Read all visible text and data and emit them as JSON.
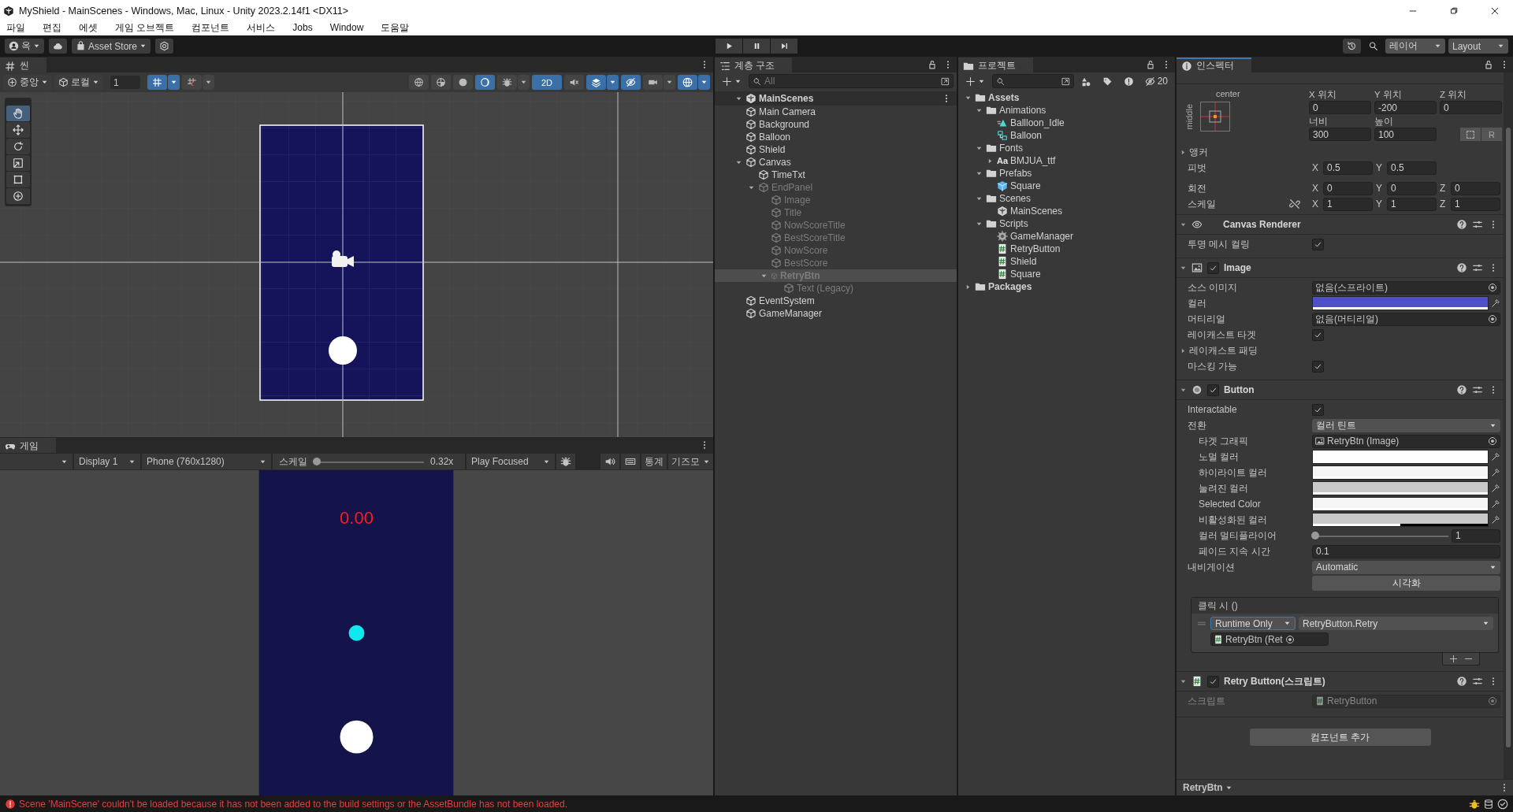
{
  "window": {
    "title": "MyShield - MainScenes - Windows, Mac, Linux - Unity 2023.2.14f1 <DX11>"
  },
  "menu": [
    "파일",
    "편집",
    "에셋",
    "게임 오브젝트",
    "컴포넌트",
    "서비스",
    "Jobs",
    "Window",
    "도움말"
  ],
  "toolbar": {
    "account": "옥",
    "asset_store": "Asset Store",
    "layers": "레이어",
    "layout": "Layout"
  },
  "scene": {
    "tab": "씬",
    "pivot": "중앙",
    "space": "로컬",
    "increment": "1",
    "snap_toggles": [
      {
        "kind": "grid",
        "on": true
      },
      {
        "kind": "snap",
        "on": false
      }
    ],
    "view_toggles": [
      {
        "kind": "wireframe",
        "on": false
      },
      {
        "kind": "shaded_wireframe",
        "on": false
      },
      {
        "kind": "shaded",
        "on": false
      },
      {
        "kind": "unlit",
        "on": true
      },
      {
        "kind": "debug",
        "on": false
      },
      {
        "kind": "mode_2d",
        "label": "2D",
        "on": true
      },
      {
        "kind": "audio",
        "on": false
      },
      {
        "kind": "effects",
        "on": true
      },
      {
        "kind": "visibility",
        "on": true
      },
      {
        "kind": "camera",
        "on": false
      },
      {
        "kind": "gizmos",
        "on": true
      }
    ],
    "tools": [
      {
        "kind": "hand",
        "selected": true
      },
      {
        "kind": "move",
        "selected": false
      },
      {
        "kind": "rotate",
        "selected": false
      },
      {
        "kind": "scale",
        "selected": false
      },
      {
        "kind": "rect",
        "selected": false
      },
      {
        "kind": "transform",
        "selected": false
      }
    ]
  },
  "game": {
    "tab": "게임",
    "display": "Display 1",
    "resolution": "Phone (760x1280)",
    "scale_label": "스케일",
    "scale": {
      "level": 0
    },
    "scale_value": "0.32x",
    "play_mode": "Play Focused",
    "stats": "통계",
    "gizmos": "기즈모",
    "timer": "0.00"
  },
  "hierarchy": {
    "tab": "계층 구조",
    "search": {
      "placeholder": "All"
    },
    "scene": {
      "name": "MainScenes",
      "expanded": true
    },
    "items": [
      {
        "name": "Main Camera",
        "active": true,
        "selected": false
      },
      {
        "name": "Background",
        "active": true,
        "selected": false
      },
      {
        "name": "Balloon",
        "active": true,
        "selected": false
      },
      {
        "name": "Shield",
        "active": true,
        "selected": false
      },
      {
        "name": "Canvas",
        "active": true,
        "selected": false,
        "expanded": true,
        "children": [
          {
            "name": "TimeTxt",
            "active": true,
            "selected": false
          },
          {
            "name": "EndPanel",
            "active": false,
            "selected": false,
            "expanded": true,
            "children": [
              {
                "name": "Image",
                "active": false,
                "selected": false
              },
              {
                "name": "Title",
                "active": false,
                "selected": false
              },
              {
                "name": "NowScoreTitle",
                "active": false,
                "selected": false
              },
              {
                "name": "BestScoreTitle",
                "active": false,
                "selected": false
              },
              {
                "name": "NowScore",
                "active": false,
                "selected": false
              },
              {
                "name": "BestScore",
                "active": false,
                "selected": false
              },
              {
                "name": "RetryBtn",
                "active": false,
                "selected": true,
                "expanded": true,
                "children": [
                  {
                    "name": "Text (Legacy)",
                    "active": false,
                    "selected": false
                  }
                ]
              }
            ]
          }
        ]
      },
      {
        "name": "EventSystem",
        "active": true,
        "selected": false
      },
      {
        "name": "GameManager",
        "active": true,
        "selected": false
      }
    ]
  },
  "project": {
    "tab": "프로젝트",
    "hidden_count": "20",
    "tree": [
      {
        "name": "Assets",
        "kind": "folder",
        "expanded": true,
        "children": [
          {
            "name": "Animations",
            "kind": "folder",
            "expanded": true,
            "children": [
              {
                "name": "Ballloon_Idle",
                "kind": "animation"
              },
              {
                "name": "Balloon",
                "kind": "controller"
              }
            ]
          },
          {
            "name": "Fonts",
            "kind": "folder",
            "expanded": true,
            "children": [
              {
                "name": "BMJUA_ttf",
                "kind": "font",
                "icon_text": "Aa",
                "expanded": false
              }
            ]
          },
          {
            "name": "Prefabs",
            "kind": "folder",
            "expanded": true,
            "children": [
              {
                "name": "Square",
                "kind": "prefab"
              }
            ]
          },
          {
            "name": "Scenes",
            "kind": "folder",
            "expanded": true,
            "children": [
              {
                "name": "MainScenes",
                "kind": "scene"
              }
            ]
          },
          {
            "name": "Scripts",
            "kind": "folder",
            "expanded": true,
            "children": [
              {
                "name": "GameManager",
                "kind": "manager_script"
              },
              {
                "name": "RetryButton",
                "kind": "script"
              },
              {
                "name": "Shield",
                "kind": "script"
              },
              {
                "name": "Square",
                "kind": "script"
              }
            ]
          }
        ]
      },
      {
        "name": "Packages",
        "kind": "folder",
        "expanded": false
      }
    ]
  },
  "inspector": {
    "tab": "인스펙터",
    "rect_transform": {
      "anchor_h": "center",
      "anchor_v": "middle",
      "position": [
        {
          "label": "X 위치",
          "value": "0"
        },
        {
          "label": "Y 위치",
          "value": "-200"
        },
        {
          "label": "Z 위치",
          "value": "0"
        }
      ],
      "size": [
        {
          "label": "너비",
          "value": "300"
        },
        {
          "label": "높이",
          "value": "100"
        }
      ],
      "raw_button": "R",
      "anchors": {
        "label": "앵커",
        "expanded": false
      },
      "rows": [
        {
          "label": "피벗",
          "axes": [
            {
              "axis": "X",
              "value": "0.5"
            },
            {
              "axis": "Y",
              "value": "0.5"
            }
          ]
        },
        {
          "label": "회전",
          "axes": [
            {
              "axis": "X",
              "value": "0"
            },
            {
              "axis": "Y",
              "value": "0"
            },
            {
              "axis": "Z",
              "value": "0"
            }
          ]
        },
        {
          "label": "스케일",
          "linked": false,
          "axes": [
            {
              "axis": "X",
              "value": "1"
            },
            {
              "axis": "Y",
              "value": "1"
            },
            {
              "axis": "Z",
              "value": "1"
            }
          ]
        }
      ]
    },
    "components": [
      {
        "kind": "canvas_renderer",
        "title": "Canvas Renderer",
        "expanded": true,
        "props": [
          {
            "kind": "checkbox",
            "label": "투명 메시 컬링",
            "checked": true
          }
        ]
      },
      {
        "kind": "image",
        "title": "Image",
        "enabled": true,
        "expanded": true,
        "props": [
          {
            "kind": "object",
            "label": "소스 이미지",
            "value": "없음(스프라이트)"
          },
          {
            "kind": "color",
            "label": "컬러",
            "color": "#4f4fc8",
            "level": 1
          },
          {
            "kind": "object",
            "label": "머티리얼",
            "value": "없음(머티리얼)"
          },
          {
            "kind": "checkbox",
            "label": "레이캐스트 타겟",
            "checked": true
          },
          {
            "kind": "foldout",
            "label": "레이캐스트 패딩",
            "expanded": false
          },
          {
            "kind": "checkbox",
            "label": "마스킹 가능",
            "checked": true
          }
        ]
      },
      {
        "kind": "button",
        "title": "Button",
        "enabled": true,
        "expanded": true,
        "props": [
          {
            "kind": "checkbox",
            "label": "Interactable",
            "checked": true
          },
          {
            "kind": "dropdown",
            "label": "전환",
            "value": "컬러 틴트",
            "children": [
              {
                "kind": "image_ref",
                "label": "타겟 그래픽",
                "value": "RetryBtn (Image)"
              },
              {
                "kind": "color",
                "label": "노멀 컬러",
                "color": "#ffffff",
                "level": 1
              },
              {
                "kind": "color",
                "label": "하이라이트 컬러",
                "color": "#f5f5f5",
                "level": 1
              },
              {
                "kind": "color",
                "label": "눌려진 컬러",
                "color": "#c8c8c8",
                "level": 1
              },
              {
                "kind": "color",
                "label": "Selected Color",
                "color": "#f5f5f5",
                "level": 1
              },
              {
                "kind": "color",
                "label": "비활성화된 컬러",
                "color": "#c8c8c8",
                "level": 0.5
              },
              {
                "kind": "slider",
                "label": "컬러 멀티플라이어",
                "level": 0,
                "value": "1"
              },
              {
                "kind": "text",
                "label": "페이드 지속 시간",
                "value": "0.1"
              }
            ]
          },
          {
            "kind": "dropdown",
            "label": "내비게이션",
            "value": "Automatic"
          },
          {
            "kind": "button",
            "label": "시각화"
          },
          {
            "kind": "event",
            "label": "클릭 시 ()",
            "runtime": "Runtime Only",
            "function": "RetryButton.Retry",
            "target": "RetryBtn (Ret"
          }
        ]
      },
      {
        "kind": "script",
        "title": "Retry Button(스크립트)",
        "enabled": true,
        "expanded": true,
        "props": [
          {
            "kind": "script_ref",
            "label": "스크립트",
            "value": "RetryButton",
            "disabled": true
          }
        ]
      }
    ],
    "add_component": "컴포넌트 추가",
    "footer": {
      "selection": "RetryBtn"
    }
  },
  "status": {
    "kind": "error",
    "message": "Scene 'MainScene' couldn't be loaded because it has not been added to the build settings or the AssetBundle has not been loaded."
  }
}
